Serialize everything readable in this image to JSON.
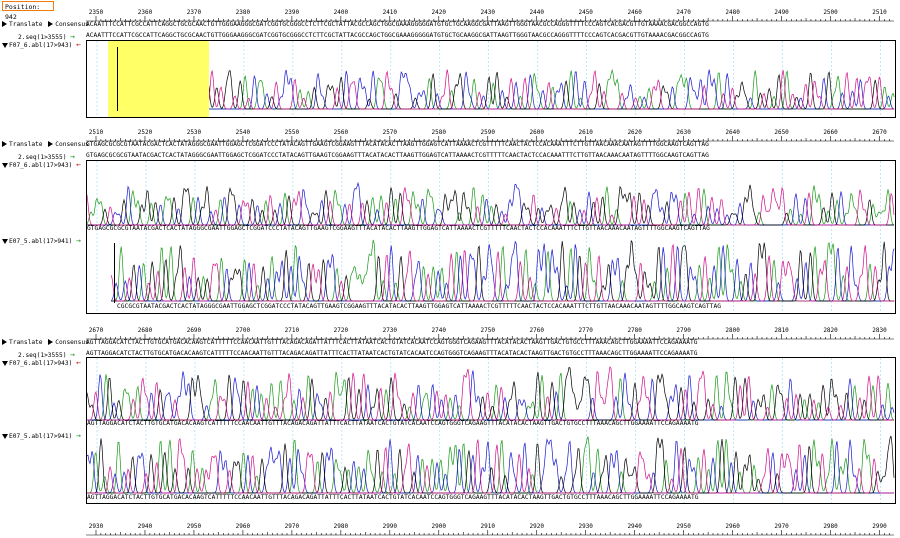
{
  "position": {
    "label": "Position: 942"
  },
  "labels": {
    "translate": "Translate",
    "consensus": "Consensus",
    "seq_ref": "2.seq(1>3555)",
    "read1": "F07_6.abl(17>943)",
    "read2": "E07_5.abl(17>941)"
  },
  "blocks": [
    {
      "ruler": [
        "2350",
        "2360",
        "2370",
        "2380",
        "2390",
        "2400",
        "2410",
        "2420",
        "2430",
        "2440",
        "2450",
        "2460",
        "2470",
        "2480",
        "2490",
        "2500",
        "2510"
      ],
      "consensus": "ACAATTTCCATTCGCCATTCAGGCTGCGCAACTGTTGGGAAGGGCGATCGGTGCGGGCCTCTTCGCTATTACGCCAGCTGGCGAAAGGGGGATGTGCTGCAAGGCGATTAAGTTGGGTAACGCCAGGGTTTTCCCAGTCACGACGTTGTAAAACGACGGCCAGTG",
      "seq": "ACAATTTCCATTCGCCATTCAGGCTGCGCAACTGTTGGGAAGGGCGATCGGTGCGGGCCTCTTCGCTATTACGCCAGCTGGCGAAAGGGGGATGTGCTGCAAGGCGATTAAGTTGGGTAACGCCAGGGTTTTCCCAGTCACGACGTTGTAAAACGACGGCCAGTG",
      "read1": "TTCCATTCGCCATTCAGGCTGCGCAACTGTTGGGAAGGGCGATCGGTGCGGGCCTCTTCGCTATTACGCCAGCTGGCGAAAGGGGGATGTGCTGCAAGGCGATTAAGTTGGGTAACGCCAGGGTTTTCCCAGTCACGACGTTGTAAAACGACGGCCAGTG"
    },
    {
      "ruler": [
        "2510",
        "2520",
        "2530",
        "2540",
        "2550",
        "2560",
        "2570",
        "2580",
        "2590",
        "2600",
        "2610",
        "2620",
        "2630",
        "2640",
        "2650",
        "2660",
        "2670"
      ],
      "consensus": "GTGAGCGCGCGTAATACGACTCACTATAGGGCGAATTGGAGCTCGGATCCCTATACAGTTGAAGTCGGAAGTTTACATACACTTAAGTTGGAGTCATTAAAACTCGTTTTTCAACTACTCCACAAATTTCTTGTTAACAAACAATAGTTTTGGCAAGTCAGTTAG",
      "seq": "GTGAGCGCGCGTAATACGACTCACTATAGGGCGAATTGGAGCTCGGATCCCTATACAGTTGAAGTCGGAAGTTTACATACACTTAAGTTGGAGTCATTAAAACTCGTTTTTCAACTACTCCACAAATTTCTTGTTAACAAACAATAGTTTTGGCAAGTCAGTTAG",
      "read1": "GTGAGCGCGCGTAATACGACTCACTATAGGGCGAATTGGAGCTCGGATCCCTATACAGTTGAAGTCGGAAGTTTACATACACTTAAGTTGGAGTCATTAAAACTCGTTTTTCAACTACTCCACAAATTTCTTGTTAACAAACAATAGTTTTGGCAAGTCAGTTAG",
      "read2": "CGCGCGTAATACGACTCACTATAGGGCGAATTGGAGCTCGGATCCCTATACAGTTGAAGTCGGAAGTTTACATACACTTAAGTTGGAGTCATTAAAACTCGTTTTTCAACTACTCCACAAATTTCTTGTTAACAAACAATAGTTTTGGCAAGTCAGTTAG"
    },
    {
      "ruler": [
        "2670",
        "2680",
        "2690",
        "2700",
        "2710",
        "2720",
        "2730",
        "2740",
        "2750",
        "2760",
        "2770",
        "2780",
        "2790",
        "2800",
        "2810",
        "2820",
        "2830"
      ],
      "consensus": "AGTTAGGACATCTACTTGTGCATGACACAAGTCATTTTTCCAACAATTGTTTACAGACAGATTATTTCACTTATAATCACTGTATCACAATCCAGTGGGTCAGAAGTTTACATACACTAAGTTGACTGTGCCTTTAAACAGCTTGGAAAATTCCAGAAAATG",
      "seq": "AGTTAGGACATCTACTTGTGCATGACACAAGTCATTTTTCCAACAATTGTTTACAGACAGATTATTTCACTTATAATCACTGTATCACAATCCAGTGGGTCAGAAGTTTACATACACTAAGTTGACTGTGCCTTTAAACAGCTTGGAAAATTCCAGAAAATG",
      "read1": "AGTTAGGACATCTACTTGTGCATGACACAAGTCATTTTTCCAACAATTGTTTACAGACAGATTATTTCACTTATAATCACTGTATCACAATCCAGTGGGTCAGAAGTTTACATACACTAAGTTGACTGTGCCTTTAAACAGCTTGGAAAATTCCAGAAAATG",
      "read2": "AGTTAGGACATCTACTTGTGCATGACACAAGTCATTTTTCCAACAATTGTTTACAGACAGATTATTTCACTTATAATCACTGTATCACAATCCAGTGGGTCAGAAGTTTACATACACTAAGTTGACTGTGCCTTTAAACAGCTTGGAAAATTCCAGAAAATG"
    }
  ],
  "bottom_ruler": [
    "2930",
    "2940",
    "2950",
    "2960",
    "2970",
    "2980",
    "2990",
    "2900",
    "2910",
    "2920",
    "2930",
    "2940",
    "2950",
    "2960",
    "2970",
    "2980",
    "2990"
  ],
  "colors": {
    "A": "#1a9a1a",
    "C": "#1818d0",
    "G": "#000000",
    "T": "#d0108a",
    "highlight": "#ffff66",
    "position_border": "#f07c10",
    "guide": "#7fd0f0"
  }
}
